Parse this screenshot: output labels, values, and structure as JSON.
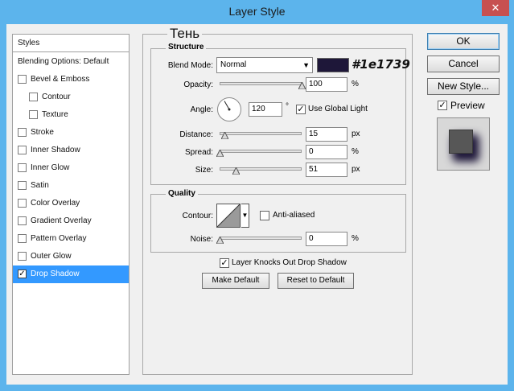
{
  "window": {
    "title": "Layer Style",
    "close_glyph": "✕"
  },
  "styles_list": {
    "header": "Styles",
    "items": [
      {
        "label": "Blending Options: Default",
        "has_checkbox": false,
        "checked": false,
        "indent": 0
      },
      {
        "label": "Bevel & Emboss",
        "has_checkbox": true,
        "checked": false,
        "indent": 0
      },
      {
        "label": "Contour",
        "has_checkbox": true,
        "checked": false,
        "indent": 1
      },
      {
        "label": "Texture",
        "has_checkbox": true,
        "checked": false,
        "indent": 1
      },
      {
        "label": "Stroke",
        "has_checkbox": true,
        "checked": false,
        "indent": 0
      },
      {
        "label": "Inner Shadow",
        "has_checkbox": true,
        "checked": false,
        "indent": 0
      },
      {
        "label": "Inner Glow",
        "has_checkbox": true,
        "checked": false,
        "indent": 0
      },
      {
        "label": "Satin",
        "has_checkbox": true,
        "checked": false,
        "indent": 0
      },
      {
        "label": "Color Overlay",
        "has_checkbox": true,
        "checked": false,
        "indent": 0
      },
      {
        "label": "Gradient Overlay",
        "has_checkbox": true,
        "checked": false,
        "indent": 0
      },
      {
        "label": "Pattern Overlay",
        "has_checkbox": true,
        "checked": false,
        "indent": 0
      },
      {
        "label": "Outer Glow",
        "has_checkbox": true,
        "checked": false,
        "indent": 0
      },
      {
        "label": "Drop Shadow",
        "has_checkbox": true,
        "checked": true,
        "indent": 0,
        "selected": true
      }
    ]
  },
  "panel": {
    "title": "Тень",
    "structure": {
      "title": "Structure",
      "blend_mode": {
        "label": "Blend Mode:",
        "value": "Normal"
      },
      "color": {
        "hex": "#1e1739",
        "annotation": "#1e1739"
      },
      "opacity": {
        "label": "Opacity:",
        "value": "100",
        "unit": "%",
        "fraction": 1.0
      },
      "angle": {
        "label": "Angle:",
        "value": "120",
        "unit": "°",
        "degrees": 120
      },
      "use_global_light": {
        "label": "Use Global Light",
        "checked": true
      },
      "distance": {
        "label": "Distance:",
        "value": "15",
        "unit": "px",
        "fraction": 0.06
      },
      "spread": {
        "label": "Spread:",
        "value": "0",
        "unit": "%",
        "fraction": 0.0
      },
      "size": {
        "label": "Size:",
        "value": "51",
        "unit": "px",
        "fraction": 0.2
      }
    },
    "quality": {
      "title": "Quality",
      "contour": {
        "label": "Contour:"
      },
      "anti_aliased": {
        "label": "Anti-aliased",
        "checked": false
      },
      "noise": {
        "label": "Noise:",
        "value": "0",
        "unit": "%",
        "fraction": 0.0
      }
    },
    "layer_knocks_out": {
      "label": "Layer Knocks Out Drop Shadow",
      "checked": true
    },
    "make_default": "Make Default",
    "reset_default": "Reset to Default"
  },
  "actions": {
    "ok": "OK",
    "cancel": "Cancel",
    "new_style": "New Style...",
    "preview": {
      "label": "Preview",
      "checked": true
    }
  },
  "colors": {
    "accent_selected": "#3399ff",
    "titlebar": "#5cb4ec",
    "shadow": "#1e1739"
  }
}
